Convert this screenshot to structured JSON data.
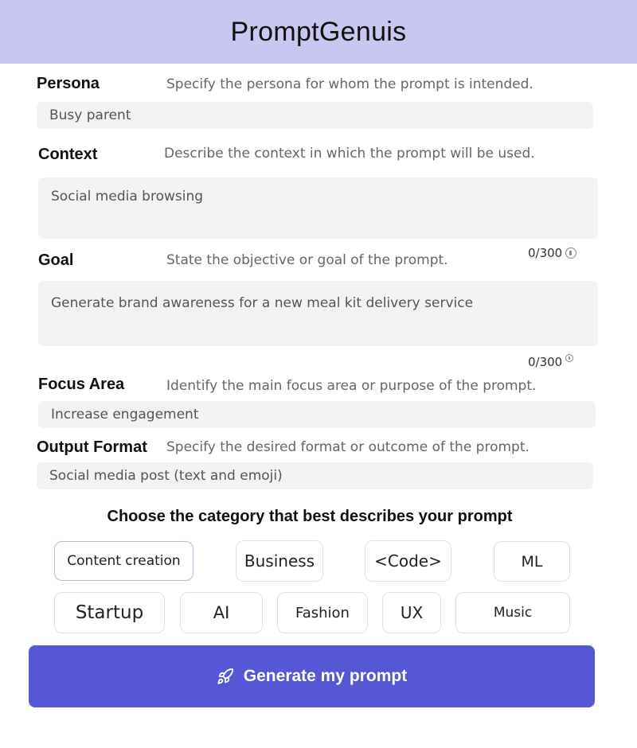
{
  "app": {
    "title": "PromptGenuis"
  },
  "persona": {
    "label": "Persona",
    "hint": "Specify the persona for whom the prompt is intended.",
    "value": "Busy parent"
  },
  "context": {
    "label": "Context",
    "hint": "Describe the context in which the prompt will be used.",
    "value": "Social media browsing",
    "counter": "0/300"
  },
  "goal": {
    "label": "Goal",
    "hint": "State the objective or goal of the prompt.",
    "value": "Generate brand awareness for a new meal kit delivery service",
    "counter": "0/300"
  },
  "focus_area": {
    "label": "Focus Area",
    "hint": "Identify the main focus area or purpose of the prompt.",
    "value": "Increase engagement"
  },
  "output_format": {
    "label": "Output Format",
    "hint": "Specify the desired format or outcome of the prompt.",
    "value": "Social media post (text and emoji)"
  },
  "categories": {
    "title": "Choose the category that best describes your prompt",
    "selected": "Content creation",
    "items": [
      {
        "label": "Content creation"
      },
      {
        "label": "Business"
      },
      {
        "label": "<Code>"
      },
      {
        "label": "ML"
      },
      {
        "label": "Startup"
      },
      {
        "label": "AI"
      },
      {
        "label": "Fashion"
      },
      {
        "label": "UX"
      },
      {
        "label": "Music"
      }
    ]
  },
  "generate_button": {
    "label": "Generate my prompt",
    "icon": "rocket-icon"
  },
  "colors": {
    "header_bg": "#c9c7f1",
    "accent": "#5657d6",
    "field_bg": "#f3f3f3"
  }
}
